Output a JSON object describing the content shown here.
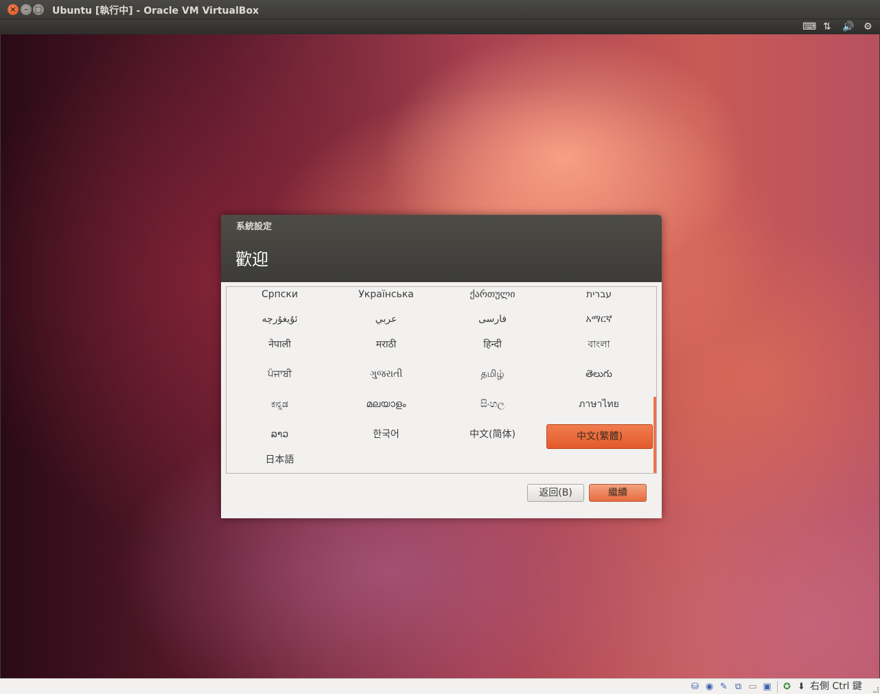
{
  "window": {
    "title": "Ubuntu [執行中] - Oracle VM VirtualBox",
    "close_glyph": "×",
    "min_glyph": "–",
    "max_glyph": "□"
  },
  "top_indicators": [
    {
      "icon": "keyboard-icon",
      "glyph": "⌨"
    },
    {
      "icon": "network-arrows-icon",
      "glyph": "⇅"
    },
    {
      "icon": "volume-icon",
      "glyph": "🔊"
    },
    {
      "icon": "gear-icon",
      "glyph": "⚙"
    }
  ],
  "dialog": {
    "title": "系統設定",
    "heading": "歡迎",
    "languages": [
      [
        "Српски",
        "Українська",
        "ქართული",
        "עברית"
      ],
      [
        "ئۇيغۇرچە",
        "عربي",
        "فارسی",
        "አማርኛ"
      ],
      [
        "नेपाली",
        "मराठी",
        "हिन्दी",
        "বাংলা"
      ],
      [
        "ਪੰਜਾਬੀ",
        "ગુજરાતી",
        "தமிழ்",
        "తెలుగు"
      ],
      [
        "ಕನ್ನಡ",
        "മലയാളം",
        "සිංහල",
        "ภาษาไทย"
      ],
      [
        "ລາວ",
        "한국어",
        "中文(简体)",
        "中文(繁體)"
      ],
      [
        "日本語"
      ]
    ],
    "selected_language": "中文(繁體)",
    "back_label": "返回(B)",
    "continue_label": "繼續"
  },
  "statusbar": {
    "icons": [
      {
        "name": "hard-disk-icon",
        "glyph": "⛁"
      },
      {
        "name": "optical-drive-icon",
        "glyph": "◉"
      },
      {
        "name": "usb-icon",
        "glyph": "✎"
      },
      {
        "name": "network-icon",
        "glyph": "⧉"
      },
      {
        "name": "shared-folders-icon",
        "glyph": "▭"
      },
      {
        "name": "display-icon",
        "glyph": "▣"
      },
      {
        "name": "virtualization-icon",
        "glyph": "✪"
      },
      {
        "name": "mouse-integration-icon",
        "glyph": "⬇"
      }
    ],
    "host_key": "右側 Ctrl 鍵"
  }
}
